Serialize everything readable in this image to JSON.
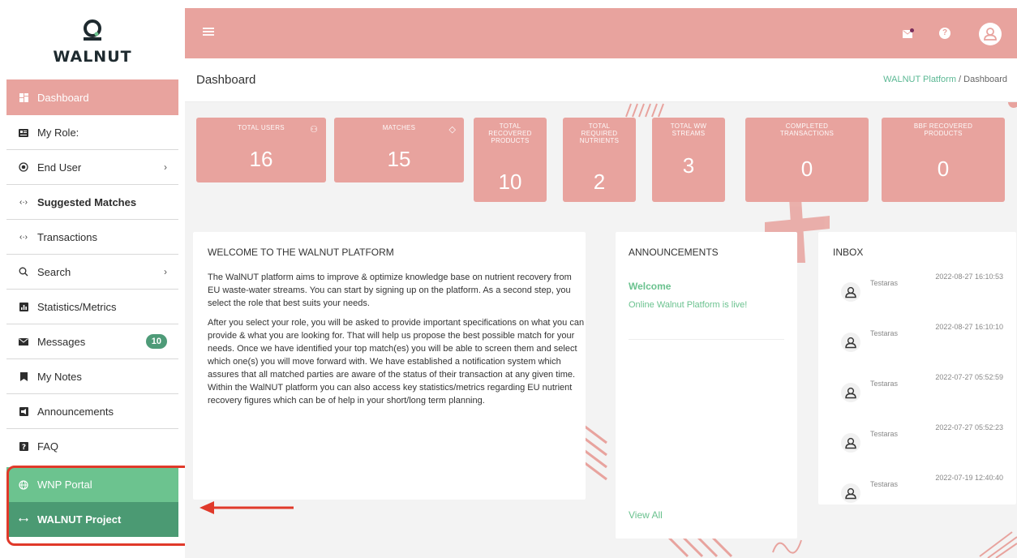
{
  "brand": {
    "name": "WALNUT"
  },
  "sidebar": {
    "items": [
      {
        "label": "Dashboard",
        "icon": "dashboard-icon",
        "active": true
      },
      {
        "label": "My Role:",
        "icon": "id-card-icon"
      },
      {
        "label": "End User",
        "icon": "radio-icon",
        "chevron": true
      },
      {
        "label": "Suggested Matches",
        "icon": "arrows-icon",
        "bold": true
      },
      {
        "label": "Transactions",
        "icon": "arrows-icon"
      },
      {
        "label": "Search",
        "icon": "search-icon",
        "chevron": true
      },
      {
        "label": "Statistics/Metrics",
        "icon": "chart-icon"
      },
      {
        "label": "Messages",
        "icon": "mail-icon",
        "badge": "10"
      },
      {
        "label": "My Notes",
        "icon": "bookmark-icon"
      },
      {
        "label": "Announcements",
        "icon": "megaphone-icon"
      },
      {
        "label": "FAQ",
        "icon": "question-icon"
      },
      {
        "label": "WNP Portal",
        "icon": "globe-icon"
      },
      {
        "label": "WALNUT Project",
        "icon": "link-icon"
      }
    ]
  },
  "topbar": {
    "icons": [
      "menu-icon",
      "mail-icon",
      "help-icon",
      "user-icon"
    ]
  },
  "header": {
    "title": "Dashboard",
    "breadcrumb": {
      "link": "WALNUT Platform",
      "separator": " / ",
      "current": "Dashboard"
    }
  },
  "stats": [
    {
      "label": "TOTAL USERS",
      "value": "16",
      "icon": "users-icon"
    },
    {
      "label": "MATCHES",
      "value": "15",
      "icon": "tag-icon"
    },
    {
      "label": "TOTAL RECOVERED PRODUCTS",
      "value": "10"
    },
    {
      "label": "TOTAL REQUIRED NUTRIENTS",
      "value": "2"
    },
    {
      "label": "TOTAL WW STREAMS",
      "value": "3"
    },
    {
      "label": "COMPLETED TRANSACTIONS",
      "value": "0"
    },
    {
      "label": "BBF RECOVERED PRODUCTS",
      "value": "0"
    }
  ],
  "welcome": {
    "title": "WELCOME TO THE WALNUT PLATFORM",
    "p1": "The WalNUT platform aims to improve & optimize knowledge base on nutrient recovery from EU waste-water streams. You can start by signing up on the platform. As a second step, you select the role that best suits your needs.",
    "p2": "After you select your role, you will be asked to provide important specifications on what you can provide & what you are looking for. That will help us propose the best possible match for your needs. Once we have identified your top match(es) you will be able to screen them and select which one(s) you will move forward with.  We have established a notification system which assures that all matched parties are aware of the status of their transaction at any given time. Within the WalNUT platform you can also access key statistics/metrics regarding EU nutrient recovery figures which can be of help in your short/long term planning."
  },
  "announcements": {
    "title": "ANNOUNCEMENTS",
    "items": [
      {
        "title": "Welcome",
        "text": "Online Walnut Platform is live!"
      }
    ],
    "view_all": "View All"
  },
  "inbox": {
    "title": "INBOX",
    "messages": [
      {
        "from": "Testaras",
        "date": "2022-08-27 16:10:53"
      },
      {
        "from": "Testaras",
        "date": "2022-08-27 16:10:10"
      },
      {
        "from": "Testaras",
        "date": "2022-07-27 05:52:59"
      },
      {
        "from": "Testaras",
        "date": "2022-07-27 05:52:23"
      },
      {
        "from": "Testaras",
        "date": "2022-07-19 12:40:40"
      }
    ]
  },
  "colors": {
    "accent": "#e8a39e",
    "green": "#6cc38f",
    "darkgreen": "#4b9a73",
    "highlight": "#e0392a"
  }
}
